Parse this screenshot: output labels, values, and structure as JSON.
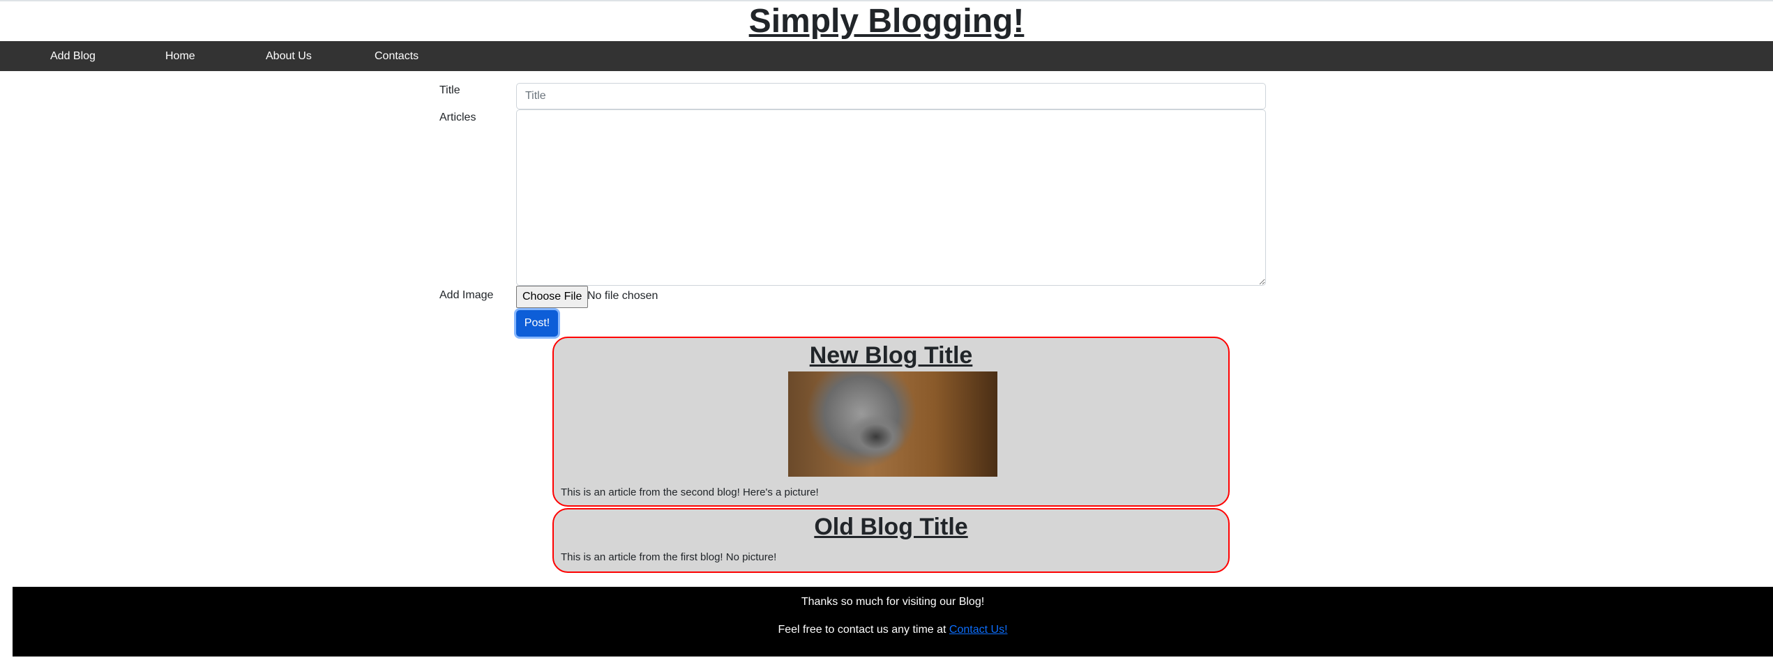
{
  "header": {
    "title": "Simply Blogging!"
  },
  "nav": {
    "items": [
      "Add Blog",
      "Home",
      "About Us",
      "Contacts"
    ]
  },
  "form": {
    "title_label": "Title",
    "title_placeholder": "Title",
    "title_value": "",
    "articles_label": "Articles",
    "articles_value": "",
    "image_label": "Add Image",
    "choose_file": "Choose File",
    "no_file": "No file chosen",
    "post": "Post!"
  },
  "posts": [
    {
      "title": "New Blog Title",
      "text": "This is an article from the second blog! Here's a picture!",
      "image": "kitten-photo"
    },
    {
      "title": "Old Blog Title",
      "text": "This is an article from the first blog! No picture!"
    }
  ],
  "footer": {
    "line1": "Thanks so much for visiting our Blog!",
    "line2": "Feel free to contact us any time at ",
    "link": "Contact Us!"
  },
  "colors": {
    "nav": "#333333",
    "card_border": "#ff0000",
    "card_bg": "#d6d6d6",
    "button": "#0d5ed8"
  }
}
